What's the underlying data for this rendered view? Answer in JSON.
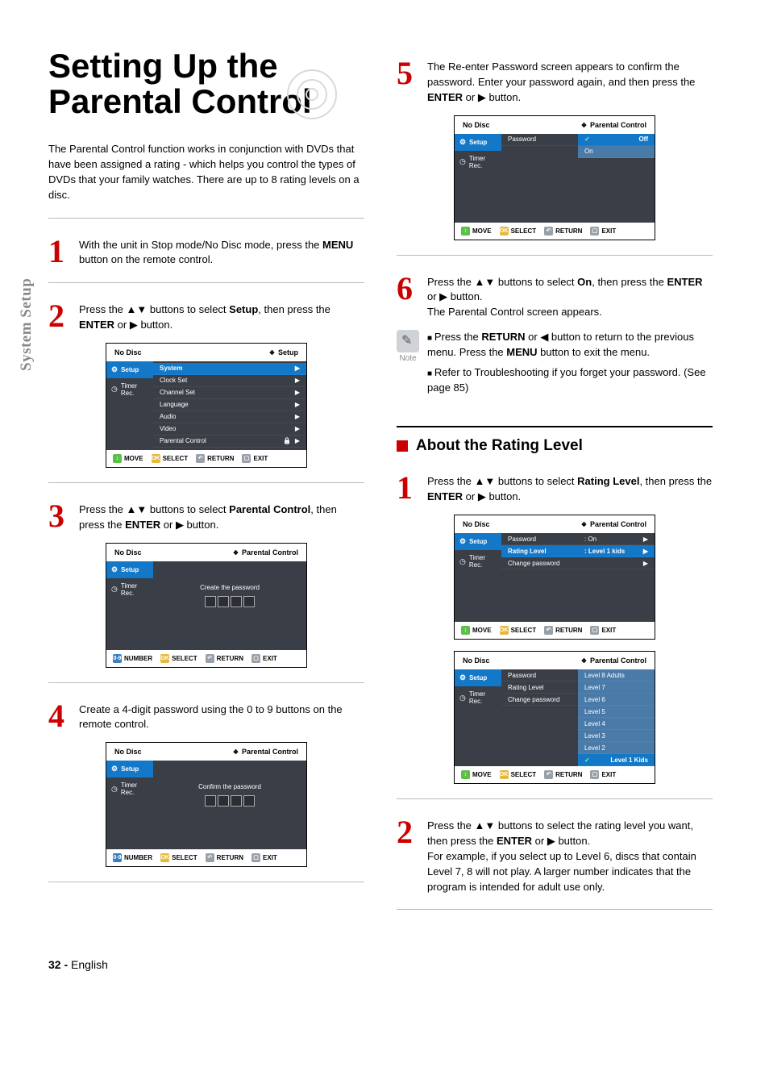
{
  "side_tab": "System Setup",
  "title": "Setting Up the Parental Control",
  "intro": "The Parental Control function works in conjunction with DVDs that have been assigned a rating - which helps you control the types of DVDs that your family watches. There are up to 8 rating levels on a disc.",
  "left_steps": {
    "s1": {
      "num": "1",
      "text_a": "With the unit in Stop mode/No Disc mode, press the ",
      "b1": "MENU",
      "text_b": " button on the remote control."
    },
    "s2": {
      "num": "2",
      "text_a": "Press the ▲▼ buttons to select ",
      "b1": "Setup",
      "text_b": ", then press the ",
      "b2": "ENTER",
      "text_c": " or ▶ button."
    },
    "s3": {
      "num": "3",
      "text_a": "Press the ▲▼ buttons to select ",
      "b1": "Parental Control",
      "text_b": ", then press the ",
      "b2": "ENTER",
      "text_c": " or ▶ button."
    },
    "s4": {
      "num": "4",
      "text_a": "Create a 4-digit password using the 0 to 9 buttons on the remote control."
    }
  },
  "right_steps": {
    "s5": {
      "num": "5",
      "text_a": "The Re-enter Password screen appears to confirm the password. Enter your password again, and then press the ",
      "b1": "ENTER",
      "text_b": " or ▶ button."
    },
    "s6": {
      "num": "6",
      "text_a": "Press the ▲▼ buttons to select ",
      "b1": "On",
      "text_b": ", then press the ",
      "b2": "ENTER",
      "text_c": " or ▶ button.",
      "text_d": "The Parental Control screen appears."
    }
  },
  "note": {
    "label": "Note",
    "b1_a": "Press the ",
    "b1_bold": "RETURN",
    "b1_b": " or ◀ button to return to the previous menu. Press the ",
    "b1_bold2": "MENU",
    "b1_c": " button to exit the menu.",
    "b2": "Refer to Troubleshooting if you forget your password. (See page 85)"
  },
  "section_heading": "About the Rating Level",
  "rating_steps": {
    "s1": {
      "num": "1",
      "text_a": "Press the ▲▼ buttons to select ",
      "b1": "Rating Level",
      "text_b": ", then press the ",
      "b2": "ENTER",
      "text_c": " or ▶ button."
    },
    "s2": {
      "num": "2",
      "text_a": "Press the ▲▼ buttons to select the rating level you want, then press the ",
      "b1": "ENTER",
      "text_b": " or ▶ button.",
      "text_c": "For example, if you select up to Level 6, discs that contain Level 7, 8 will not play. A larger number indicates that the program is intended for adult use only."
    }
  },
  "osd": {
    "no_disc": "No Disc",
    "setup_crumb": "Setup",
    "pc_crumb": "Parental Control",
    "side": {
      "setup": "Setup",
      "timer": "Timer Rec."
    },
    "setup_menu": {
      "items": [
        "System",
        "Clock Set",
        "Channel Set",
        "Language",
        "Audio",
        "Video",
        "Parental Control"
      ],
      "arrow": "▶"
    },
    "create_pw": "Create the password",
    "confirm_pw": "Confirm the password",
    "password_label": "Password",
    "off": "Off",
    "on": "On",
    "rating_menu": {
      "password_val": ": On",
      "rating_label": "Rating Level",
      "rating_val": ": Level 1 kids",
      "change_pw": "Change password"
    },
    "levels": [
      "Level 8 Adults",
      "Level 7",
      "Level 6",
      "Level 5",
      "Level 4",
      "Level 3",
      "Level 2",
      "Level 1 Kids"
    ],
    "footer": {
      "move": "MOVE",
      "select": "SELECT",
      "return": "RETURN",
      "exit": "EXIT",
      "number": "NUMBER"
    }
  },
  "footer": {
    "page": "32 -",
    "lang": "English"
  }
}
